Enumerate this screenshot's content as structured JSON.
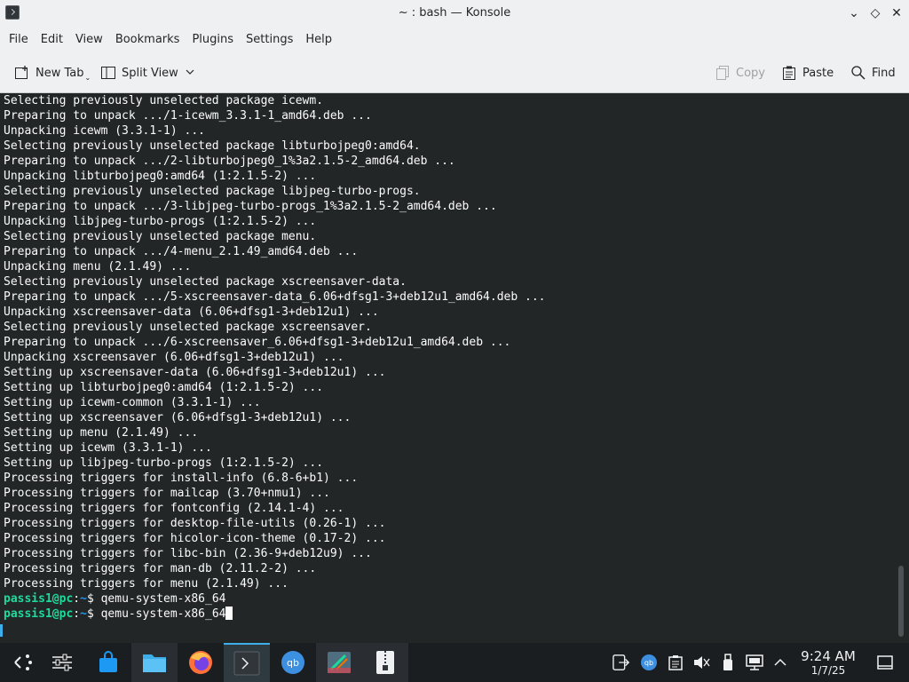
{
  "window": {
    "title": "~ : bash — Konsole",
    "minimize_glyph": "⌄",
    "maximize_glyph": "◇",
    "close_glyph": "✕"
  },
  "menu": [
    "File",
    "Edit",
    "View",
    "Bookmarks",
    "Plugins",
    "Settings",
    "Help"
  ],
  "toolbar": {
    "new_tab": "New Tab",
    "split_view": "Split View",
    "copy": "Copy",
    "paste": "Paste",
    "find": "Find"
  },
  "terminal": {
    "lines": [
      "Selecting previously unselected package icewm.",
      "Preparing to unpack .../1-icewm_3.3.1-1_amd64.deb ...",
      "Unpacking icewm (3.3.1-1) ...",
      "Selecting previously unselected package libturbojpeg0:amd64.",
      "Preparing to unpack .../2-libturbojpeg0_1%3a2.1.5-2_amd64.deb ...",
      "Unpacking libturbojpeg0:amd64 (1:2.1.5-2) ...",
      "Selecting previously unselected package libjpeg-turbo-progs.",
      "Preparing to unpack .../3-libjpeg-turbo-progs_1%3a2.1.5-2_amd64.deb ...",
      "Unpacking libjpeg-turbo-progs (1:2.1.5-2) ...",
      "Selecting previously unselected package menu.",
      "Preparing to unpack .../4-menu_2.1.49_amd64.deb ...",
      "Unpacking menu (2.1.49) ...",
      "Selecting previously unselected package xscreensaver-data.",
      "Preparing to unpack .../5-xscreensaver-data_6.06+dfsg1-3+deb12u1_amd64.deb ...",
      "Unpacking xscreensaver-data (6.06+dfsg1-3+deb12u1) ...",
      "Selecting previously unselected package xscreensaver.",
      "Preparing to unpack .../6-xscreensaver_6.06+dfsg1-3+deb12u1_amd64.deb ...",
      "Unpacking xscreensaver (6.06+dfsg1-3+deb12u1) ...",
      "Setting up xscreensaver-data (6.06+dfsg1-3+deb12u1) ...",
      "Setting up libturbojpeg0:amd64 (1:2.1.5-2) ...",
      "Setting up icewm-common (3.3.1-1) ...",
      "Setting up xscreensaver (6.06+dfsg1-3+deb12u1) ...",
      "Setting up menu (2.1.49) ...",
      "Setting up icewm (3.3.1-1) ...",
      "Setting up libjpeg-turbo-progs (1:2.1.5-2) ...",
      "Processing triggers for install-info (6.8-6+b1) ...",
      "Processing triggers for mailcap (3.70+nmu1) ...",
      "Processing triggers for fontconfig (2.14.1-4) ...",
      "Processing triggers for desktop-file-utils (0.26-1) ...",
      "Processing triggers for hicolor-icon-theme (0.17-2) ...",
      "Processing triggers for libc-bin (2.36-9+deb12u9) ...",
      "Processing triggers for man-db (2.11.2-2) ...",
      "Processing triggers for menu (2.1.49) ..."
    ],
    "prompt": {
      "user_host": "passis1@pc",
      "sep": ":",
      "path": "~",
      "symbol": "$ "
    },
    "commands": [
      "qemu-system-x86_64",
      "qemu-system-x86_64"
    ]
  },
  "taskbar": {
    "apps": [
      "app-launcher-icon",
      "system-settings-icon",
      "discover-store-icon",
      "dolphin-files-icon",
      "firefox-icon",
      "konsole-icon",
      "qbittorrent-icon",
      "kde-app-icon",
      "archive-manager-icon"
    ],
    "clock": {
      "time": "9:24 AM",
      "date": "1/7/25"
    }
  },
  "colors": {
    "terminal_bg": "#232627",
    "prompt_user": "#1cdc9a",
    "prompt_path": "#1d99f3",
    "accent": "#3daee9"
  }
}
